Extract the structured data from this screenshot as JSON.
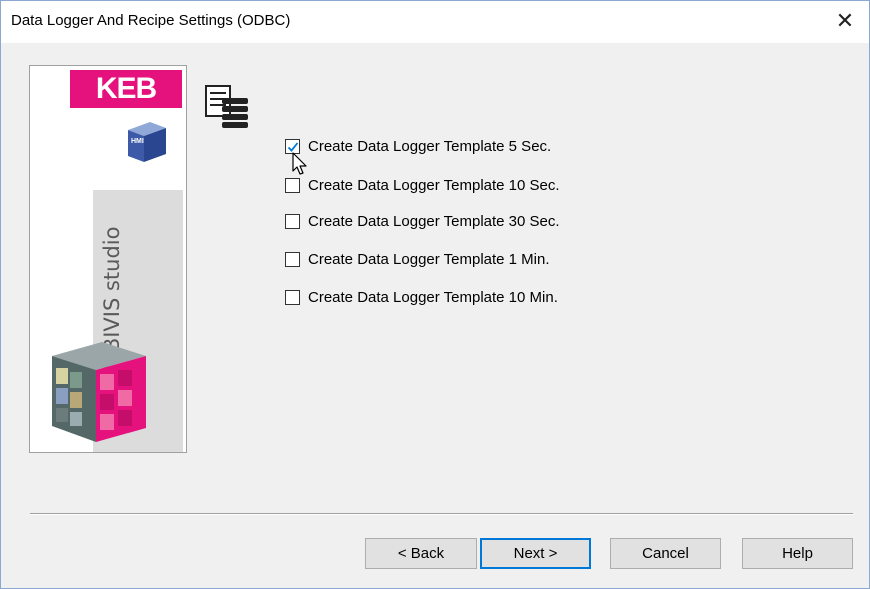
{
  "window": {
    "title": "Data Logger And Recipe Settings (ODBC)",
    "close_glyph": "✕"
  },
  "branding": {
    "logo_text": "KEB",
    "product_text": "COMBIVIS studio",
    "badge_text": "HMI"
  },
  "options": [
    {
      "label": "Create Data Logger Template 5 Sec.",
      "checked": true
    },
    {
      "label": "Create Data Logger Template 10 Sec.",
      "checked": false
    },
    {
      "label": "Create Data Logger Template 30 Sec.",
      "checked": false
    },
    {
      "label": "Create Data Logger Template 1 Min.",
      "checked": false
    },
    {
      "label": "Create Data Logger Template 10 Min.",
      "checked": false
    }
  ],
  "buttons": {
    "back": "< Back",
    "next": "Next >",
    "cancel": "Cancel",
    "help": "Help"
  },
  "colors": {
    "accent": "#0078d7",
    "brand": "#e5127d"
  },
  "icons": [
    "close-icon",
    "document-list-icon",
    "mouse-cursor-icon",
    "checkmark-icon"
  ]
}
